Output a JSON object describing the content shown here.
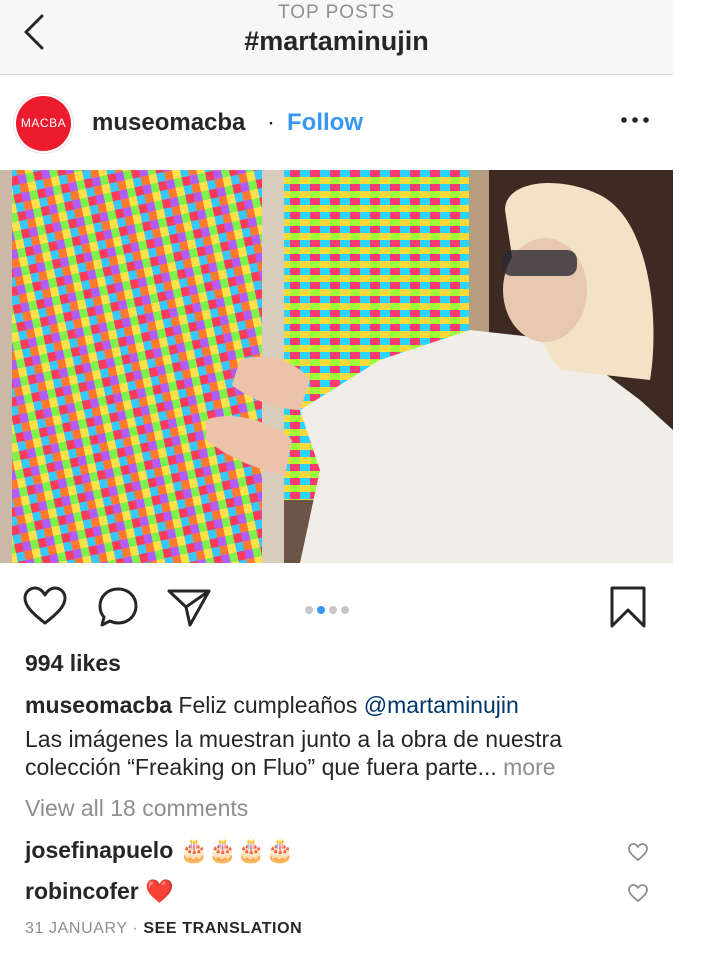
{
  "header": {
    "subtitle": "TOP POSTS",
    "title": "#martaminujin"
  },
  "post": {
    "username": "museomacba",
    "avatar_text": "MACBA",
    "separator": "·",
    "follow_label": "Follow",
    "image_alt": "Marta Minujín touching a colorful fluorescent artwork",
    "carousel": {
      "count": 4,
      "active_index": 1
    },
    "likes_text": "994 likes",
    "caption": {
      "username": "museomacba",
      "text_before": "Feliz cumpleaños",
      "mention": "@martaminujin",
      "line2": "Las imágenes la muestran junto a la obra de nuestra",
      "line3": "colección “Freaking on Fluo” que fuera parte...",
      "more_label": "more"
    },
    "view_comments": "View all 18 comments",
    "comments": [
      {
        "username": "josefinapuelo",
        "emoji": "🎂🎂🎂🎂"
      },
      {
        "username": "robincofer",
        "emoji": "❤️"
      }
    ],
    "date": "31 JANUARY",
    "date_separator": "·",
    "see_translation": "SEE TRANSLATION"
  },
  "colors": {
    "link_blue": "#3897f0",
    "avatar_red": "#ec1c2e",
    "muted_grey": "#8e8e8e",
    "text_dark": "#262626"
  },
  "icons": [
    "back-arrow-icon",
    "more-options-icon",
    "heart-icon",
    "comment-icon",
    "share-icon",
    "bookmark-icon",
    "small-heart-icon",
    "birthday-cake-emoji",
    "red-heart-emoji"
  ]
}
